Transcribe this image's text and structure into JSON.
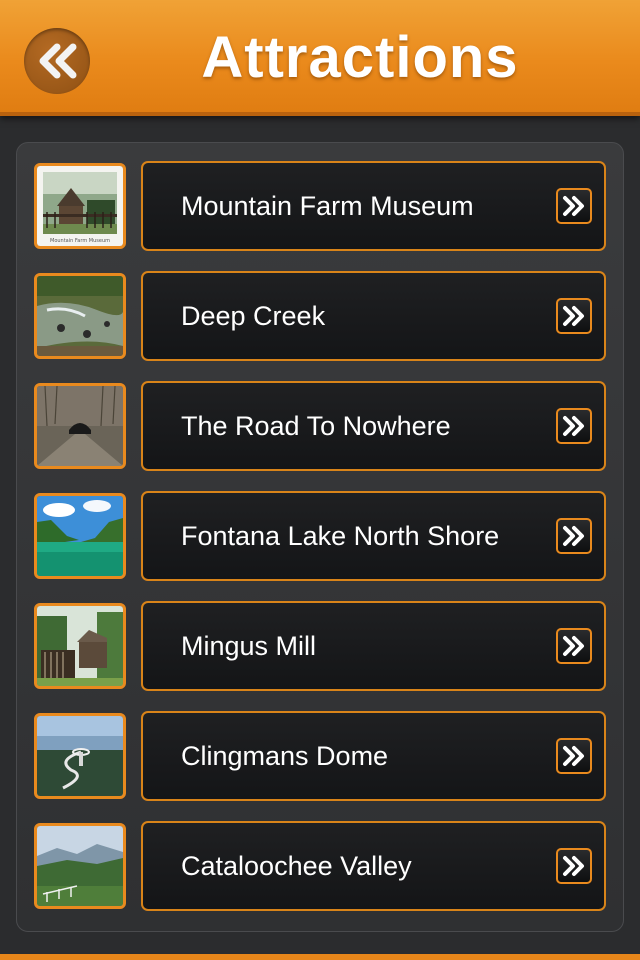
{
  "header": {
    "title": "Attractions",
    "back_icon": "double-chevron-left-icon",
    "accent_color": "#ea8a1c"
  },
  "attractions": [
    {
      "label": "Mountain Farm Museum",
      "thumbnail": "farm-museum-photo",
      "thumb_caption": "Mountain Farm Museum",
      "arrow_icon": "double-chevron-right-icon"
    },
    {
      "label": "Deep Creek",
      "thumbnail": "creek-tubing-photo",
      "arrow_icon": "double-chevron-right-icon"
    },
    {
      "label": "The Road To Nowhere",
      "thumbnail": "tunnel-photo",
      "arrow_icon": "double-chevron-right-icon"
    },
    {
      "label": "Fontana Lake North Shore",
      "thumbnail": "lake-photo",
      "arrow_icon": "double-chevron-right-icon"
    },
    {
      "label": "Mingus Mill",
      "thumbnail": "mill-photo",
      "arrow_icon": "double-chevron-right-icon"
    },
    {
      "label": "Clingmans Dome",
      "thumbnail": "dome-tower-photo",
      "arrow_icon": "double-chevron-right-icon"
    },
    {
      "label": "Cataloochee Valley",
      "thumbnail": "valley-photo",
      "arrow_icon": "double-chevron-right-icon"
    }
  ]
}
